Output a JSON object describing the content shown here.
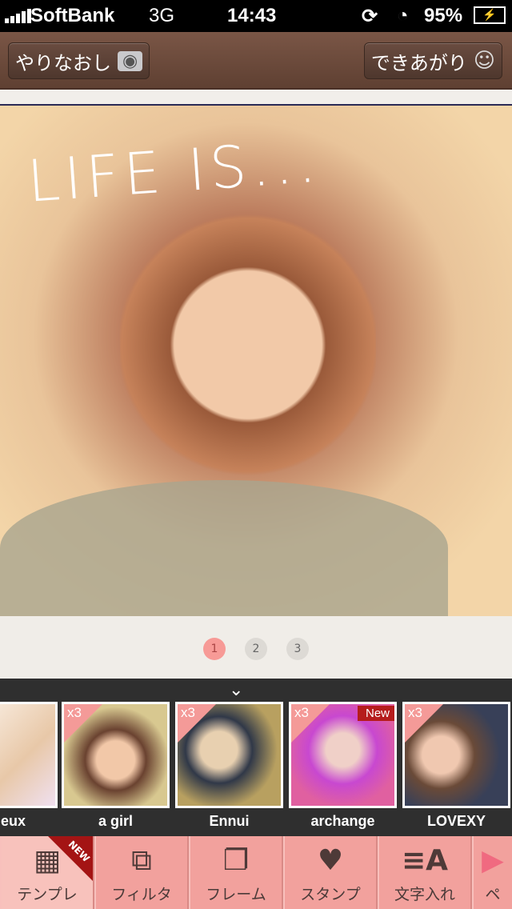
{
  "status": {
    "carrier": "SoftBank",
    "network": "3G",
    "time": "14:43",
    "battery": "95%"
  },
  "nav": {
    "retake_label": "やりなおし",
    "done_label": "できあがり"
  },
  "photo": {
    "overlay_text": "LIFE IS..."
  },
  "pager": {
    "pages": [
      "1",
      "2",
      "3"
    ],
    "current": 1
  },
  "templates": [
    {
      "label": "eux",
      "badge": "",
      "new": ""
    },
    {
      "label": "a girl",
      "badge": "x3",
      "new": ""
    },
    {
      "label": "Ennui",
      "badge": "x3",
      "new": ""
    },
    {
      "label": "archange",
      "badge": "x3",
      "new": "New"
    },
    {
      "label": "LOVEXY",
      "badge": "x3",
      "new": ""
    }
  ],
  "tools": [
    {
      "label": "テンプレ",
      "ribbon": "NEW"
    },
    {
      "label": "フィルタ"
    },
    {
      "label": "フレーム"
    },
    {
      "label": "スタンプ"
    },
    {
      "label": "文字入れ"
    },
    {
      "label": "ペ"
    }
  ],
  "colors": {
    "accent": "#f79a96",
    "nav": "#6b4a3c",
    "tray": "#2f2f2f",
    "toolbar": "#f2a19d"
  }
}
